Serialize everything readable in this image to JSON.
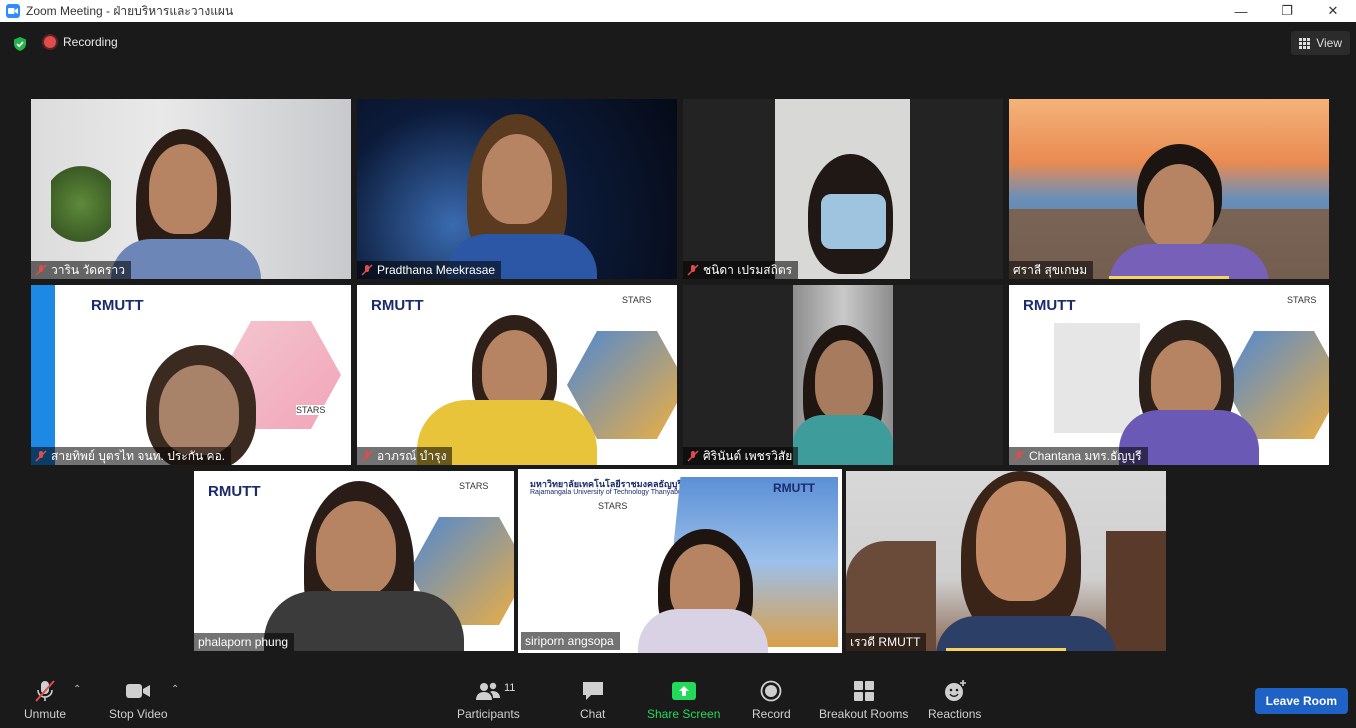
{
  "window": {
    "title": "Zoom Meeting - ฝ่ายบริหารและวางแผน"
  },
  "topbar": {
    "recording_label": "Recording",
    "view_label": "View"
  },
  "participants": [
    {
      "name": "วาริน  วัดคราว",
      "muted": true
    },
    {
      "name": "Pradthana Meekrasae",
      "muted": true
    },
    {
      "name": "ชนิดา เปรมสถิตร",
      "muted": true
    },
    {
      "name": "ศราลี สุขเกษม",
      "muted": false,
      "speaking": true
    },
    {
      "name": "สายทิพย์  บุตรไท จนท. ประกัน คอ.",
      "muted": true
    },
    {
      "name": "อาภรณ์ บำรุง",
      "muted": true
    },
    {
      "name": "ศิรินันต์ เพชรวิสัย",
      "muted": true
    },
    {
      "name": "Chantana มทร.ธัญบุรี",
      "muted": true
    },
    {
      "name": "phalaporn phung",
      "muted": false
    },
    {
      "name": "siriporn angsopa",
      "muted": false,
      "active": true
    },
    {
      "name": "เรวดี RMUTT",
      "muted": false,
      "speaking": true
    }
  ],
  "slides": {
    "logo_text": "RMUTT",
    "stars_text": "STARS",
    "university_th": "มหาวิทยาลัยเทคโนโลยีราชมงคลธัญบุรี",
    "university_en": "Rajamangala University of Technology Thanyaburi"
  },
  "toolbar": {
    "unmute": "Unmute",
    "stop_video": "Stop Video",
    "participants": "Participants",
    "participants_count": "11",
    "chat": "Chat",
    "share_screen": "Share Screen",
    "record": "Record",
    "breakout_rooms": "Breakout Rooms",
    "reactions": "Reactions",
    "leave_room": "Leave Room"
  },
  "colors": {
    "accent_blue": "#2d8cff",
    "share_green": "#23d959",
    "leave_button": "#1f62c5",
    "muted_red": "#e04b4b",
    "active_speaker": "#b7e04a"
  }
}
